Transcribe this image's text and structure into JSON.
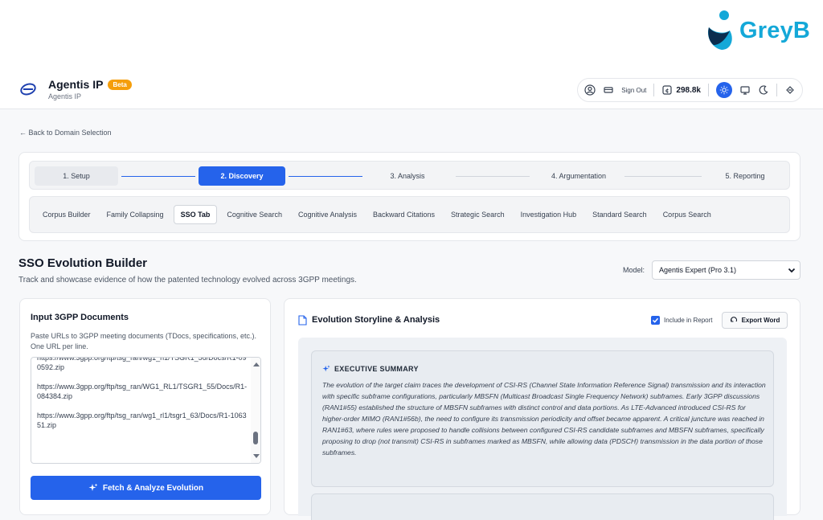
{
  "brand": {
    "name": "GreyB",
    "color": "#14a8d8"
  },
  "header": {
    "title": "Agentis IP",
    "badge": "Beta",
    "subtitle": "Agentis IP",
    "sign_out": "Sign Out",
    "credits": "298.8k",
    "icons": [
      "user-circle-icon",
      "card-icon",
      "coin-icon",
      "sun-icon",
      "monitor-icon",
      "moon-icon",
      "palette-icon"
    ]
  },
  "nav": {
    "back": "← Back to Domain Selection"
  },
  "steps": [
    {
      "label": "1. Setup"
    },
    {
      "label": "2. Discovery"
    },
    {
      "label": "3. Analysis"
    },
    {
      "label": "4. Argumentation"
    },
    {
      "label": "5. Reporting"
    }
  ],
  "tabs": [
    {
      "label": "Corpus Builder"
    },
    {
      "label": "Family Collapsing"
    },
    {
      "label": "SSO Tab"
    },
    {
      "label": "Cognitive Search"
    },
    {
      "label": "Cognitive Analysis"
    },
    {
      "label": "Backward Citations"
    },
    {
      "label": "Strategic Search"
    },
    {
      "label": "Investigation Hub"
    },
    {
      "label": "Standard Search"
    },
    {
      "label": "Corpus Search"
    }
  ],
  "section": {
    "title": "SSO Evolution Builder",
    "subtitle": "Track and showcase evidence of how the patented technology evolved across 3GPP meetings.",
    "model_label": "Model:",
    "model_value": "Agentis Expert (Pro 3.1)"
  },
  "input_card": {
    "title": "Input 3GPP Documents",
    "description": "Paste URLs to 3GPP meeting documents (TDocs, specifications, etc.). One URL per line.",
    "urls": [
      "https://www.3gpp.org/ftp/tsg_ran/wg1_rl1/TSGR1_56/Docs/R1-090592.zip",
      "https://www.3gpp.org/ftp/tsg_ran/WG1_RL1/TSGR1_55/Docs/R1-084384.zip",
      "https://www.3gpp.org/ftp/tsg_ran/wg1_rl1/tsgr1_63/Docs/R1-106351.zip"
    ],
    "fetch_button": "Fetch & Analyze Evolution"
  },
  "analysis_card": {
    "title": "Evolution Storyline & Analysis",
    "include_label": "Include in Report",
    "include_checked": true,
    "export_button": "Export Word",
    "summary_heading": "EXECUTIVE SUMMARY",
    "summary_text": "The evolution of the target claim traces the development of CSI-RS (Channel State Information Reference Signal) transmission and its interaction with specific subframe configurations, particularly MBSFN (Multicast Broadcast Single Frequency Network) subframes. Early 3GPP discussions (RAN1#55) established the structure of MBSFN subframes with distinct control and data portions. As LTE-Advanced introduced CSI-RS for higher-order MIMO (RAN1#56b), the need to configure its transmission periodicity and offset became apparent. A critical juncture was reached in RAN1#63, where rules were proposed to handle collisions between configured CSI-RS candidate subframes and MBSFN subframes, specifically proposing to drop (not transmit) CSI-RS in subframes marked as MBSFN, while allowing data (PDSCH) transmission in the data portion of those subframes."
  },
  "colors": {
    "primary": "#2563eb",
    "beta_badge": "#f59e0b",
    "page_bg": "#f7f8fa",
    "summary_bg": "#e8ecf1"
  }
}
